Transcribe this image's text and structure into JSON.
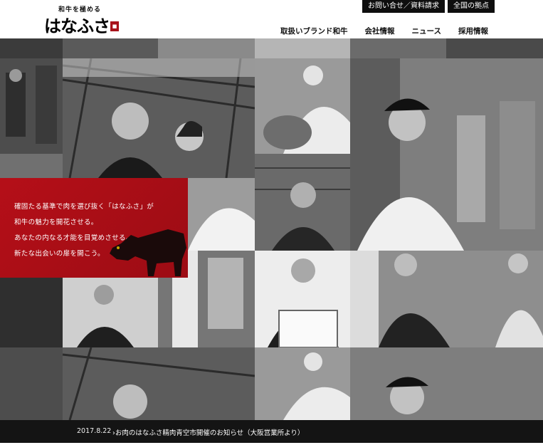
{
  "header": {
    "logo_tagline": "和牛を極める",
    "logo_text": "はなふさ",
    "logo_seal": "花房"
  },
  "top_links": [
    {
      "label": "お問い合せ／資料請求"
    },
    {
      "label": "全国の拠点"
    }
  ],
  "nav": [
    {
      "label": "取扱いブランド和牛"
    },
    {
      "label": "会社情報"
    },
    {
      "label": "ニュース"
    },
    {
      "label": "採用情報"
    }
  ],
  "hero": {
    "lines": [
      "確固たる基準で肉を選び抜く「はなふさ」が",
      "和牛の魅力を開花させる。",
      "あなたの内なる才能を目覚めさせる。",
      "新たな出会いの扉を開こう。"
    ],
    "accent_color": "#b50f18"
  },
  "news": {
    "date": "2017.8.22",
    "title": "お肉のはなふさ精肉青空市開催のお知らせ（大阪営業所より）"
  },
  "icons": {
    "news_arrow": "chevron-right-icon"
  }
}
